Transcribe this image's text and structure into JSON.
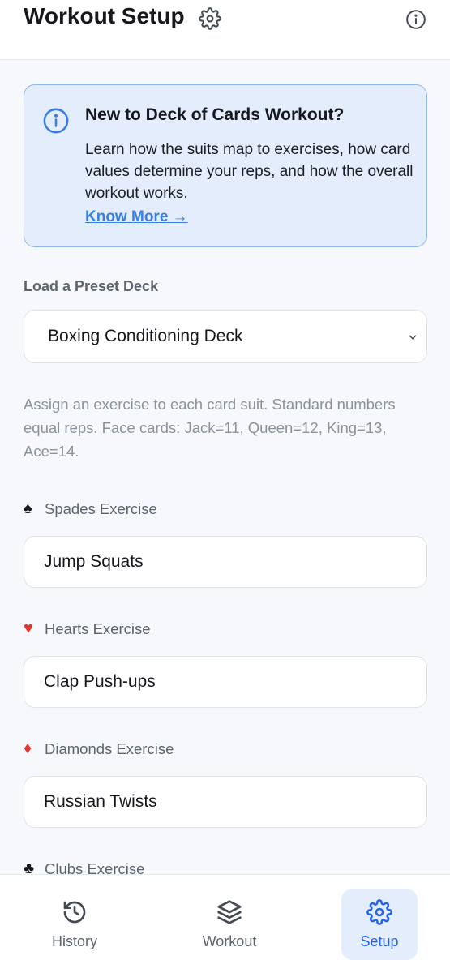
{
  "header": {
    "title": "Workout Setup",
    "settings_icon": "gear-icon",
    "info_icon": "info-circle-icon"
  },
  "info_card": {
    "icon": "info-circle-icon",
    "title": "New to Deck of Cards Workout?",
    "description": "Learn how the suits map to exercises, how card values determine your reps, and how the overall workout works.",
    "link_label": "Know More →"
  },
  "preset": {
    "label": "Load a Preset Deck",
    "selected": "Boxing Conditioning Deck"
  },
  "help_text": "Assign an exercise to each card suit. Standard numbers equal reps. Face cards: Jack=11, Queen=12, King=13, Ace=14.",
  "suits": [
    {
      "symbol": "♠",
      "label": "Spades Exercise",
      "value": "Jump Squats",
      "color": "#16181d"
    },
    {
      "symbol": "♥",
      "label": "Hearts Exercise",
      "value": "Clap Push-ups",
      "color": "#e3342f"
    },
    {
      "symbol": "♦",
      "label": "Diamonds Exercise",
      "value": "Russian Twists",
      "color": "#e3342f"
    },
    {
      "symbol": "♣",
      "label": "Clubs Exercise",
      "value": "",
      "color": "#16181d"
    }
  ],
  "nav": [
    {
      "label": "History",
      "icon": "history-icon",
      "active": false
    },
    {
      "label": "Workout",
      "icon": "layers-icon",
      "active": false
    },
    {
      "label": "Setup",
      "icon": "gear-icon",
      "active": true
    }
  ],
  "colors": {
    "accent": "#2563eb",
    "info_bg": "#e3edfc",
    "info_border": "#8fb6ea",
    "suit_red": "#e3342f"
  }
}
